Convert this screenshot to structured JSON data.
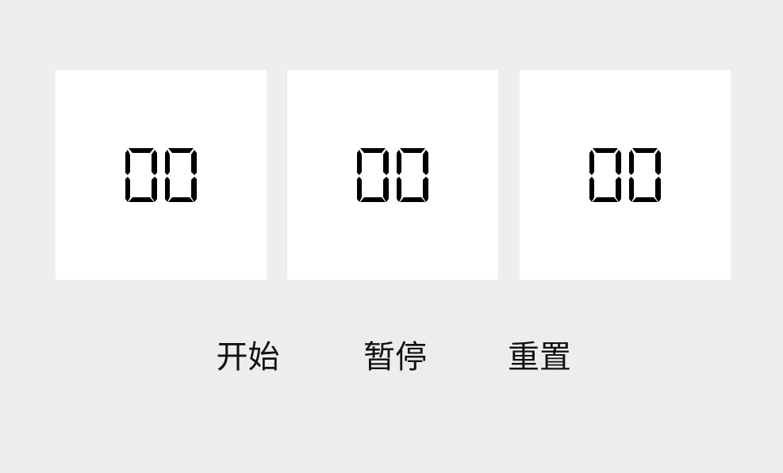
{
  "timer": {
    "segments": [
      {
        "id": "hours",
        "value": "00"
      },
      {
        "id": "minutes",
        "value": "00"
      },
      {
        "id": "seconds",
        "value": "00"
      }
    ]
  },
  "controls": {
    "start_label": "开始",
    "pause_label": "暂停",
    "reset_label": "重置"
  },
  "colors": {
    "background": "#eeeeee",
    "panel": "#ffffff",
    "digit": "#000000",
    "button": "#ededed"
  }
}
